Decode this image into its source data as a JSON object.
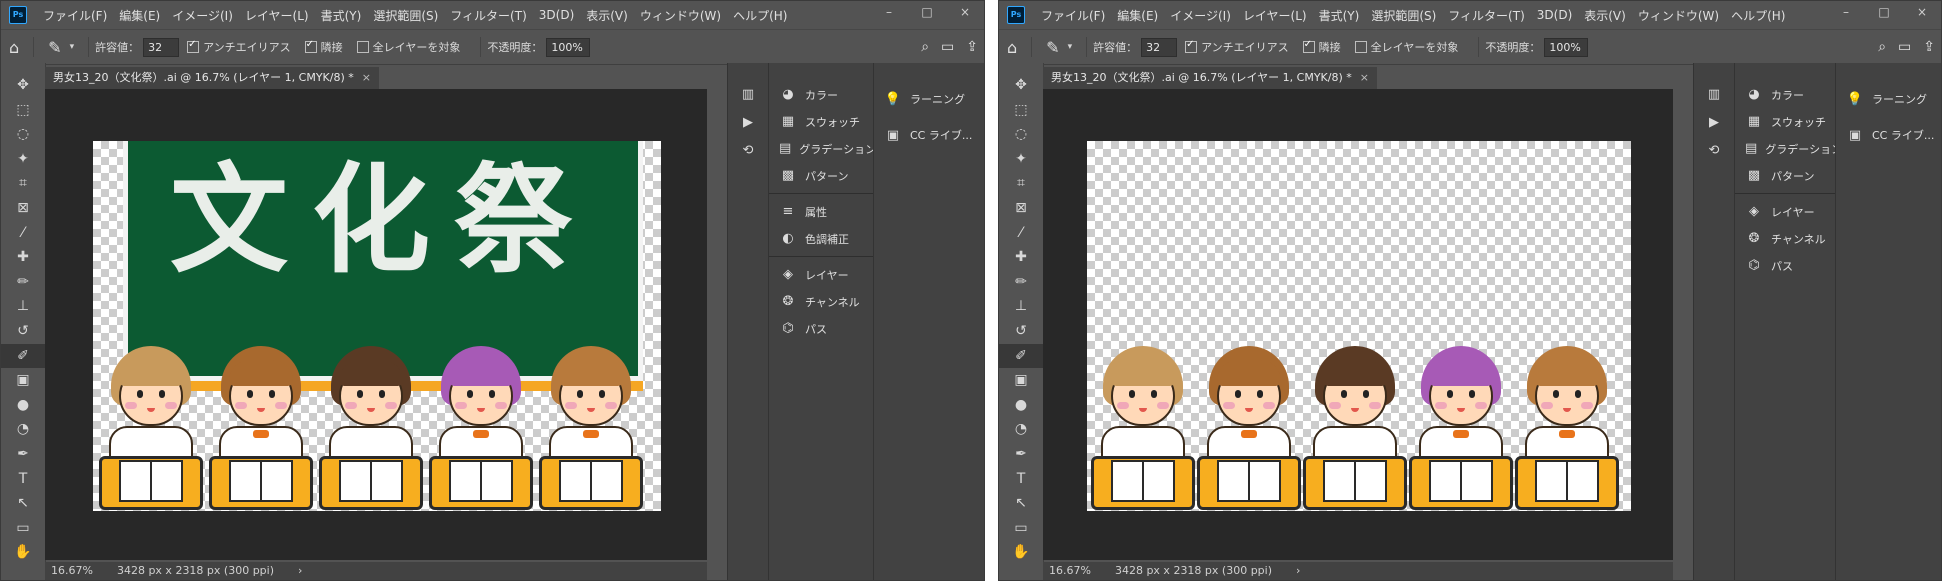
{
  "app": {
    "logo": "Ps"
  },
  "menu": [
    "ファイル(F)",
    "編集(E)",
    "イメージ(I)",
    "レイヤー(L)",
    "書式(Y)",
    "選択範囲(S)",
    "フィルター(T)",
    "3D(D)",
    "表示(V)",
    "ウィンドウ(W)",
    "ヘルプ(H)"
  ],
  "window_controls": {
    "minimize": "–",
    "maximize": "□",
    "close": "×"
  },
  "options": {
    "tolerance_label": "許容値：",
    "tolerance_value": "32",
    "antialias_label": "アンチエイリアス",
    "contiguous_label": "隣接",
    "all_layers_label": "全レイヤーを対象",
    "opacity_label": "不透明度：",
    "opacity_value": "100%"
  },
  "document": {
    "tab_title": "男女13_20（文化祭）.ai @ 16.7% (レイヤー 1, CMYK/8) *",
    "close": "×",
    "board_text": "文化祭"
  },
  "status": {
    "zoom": "16.67%",
    "size": "3428 px x 2318 px (300 ppi)",
    "arrow": "›"
  },
  "panels": {
    "group1": [
      {
        "icon": "palette-icon",
        "label": "カラー"
      },
      {
        "icon": "swatches-icon",
        "label": "スウォッチ"
      },
      {
        "icon": "gradient-icon",
        "label": "グラデーション"
      },
      {
        "icon": "pattern-icon",
        "label": "パターン"
      }
    ],
    "group2": [
      {
        "icon": "properties-icon",
        "label": "属性"
      },
      {
        "icon": "adjustments-icon",
        "label": "色調補正"
      }
    ],
    "group3": [
      {
        "icon": "layers-icon",
        "label": "レイヤー"
      },
      {
        "icon": "channels-icon",
        "label": "チャンネル"
      },
      {
        "icon": "paths-icon",
        "label": "パス"
      }
    ],
    "side": [
      {
        "icon": "learn-icon",
        "label": "ラーニング"
      },
      {
        "icon": "cc-libraries-icon",
        "label": "CC ライブ..."
      }
    ]
  },
  "kids": [
    {
      "hair": "#c89a5c",
      "fringe": "#c89a5c"
    },
    {
      "hair": "#a8692e",
      "fringe": "#a8692e"
    },
    {
      "hair": "#5a3a24",
      "fringe": "#5a3a24"
    },
    {
      "hair": "#a75ab6",
      "fringe": "#a75ab6"
    },
    {
      "hair": "#b87a3c",
      "fringe": "#b87a3c"
    }
  ]
}
